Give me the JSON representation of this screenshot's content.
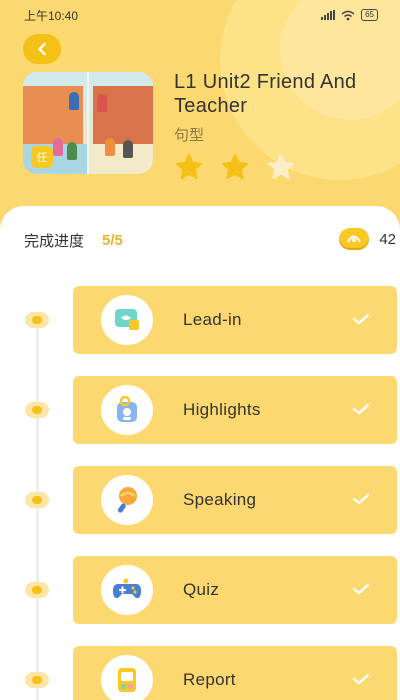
{
  "status_bar": {
    "time": "上午10:40",
    "battery": "65"
  },
  "header": {
    "title": "L1 Unit2 Friend And Teacher",
    "subtitle": "句型",
    "cover_badge": "任",
    "stars_filled": 2,
    "stars_total": 3
  },
  "progress": {
    "label": "完成进度",
    "value": "5/5",
    "coins": "42"
  },
  "lessons": [
    {
      "label": "Lead-in",
      "icon": "book-bubble-icon",
      "completed": true
    },
    {
      "label": "Highlights",
      "icon": "flashcard-icon",
      "completed": true
    },
    {
      "label": "Speaking",
      "icon": "microphone-icon",
      "completed": true
    },
    {
      "label": "Quiz",
      "icon": "gamepad-icon",
      "completed": true
    },
    {
      "label": "Report",
      "icon": "report-icon",
      "completed": true
    }
  ],
  "colors": {
    "accent": "#f5c116",
    "card": "#fcd970",
    "progress_value": "#e7b42f"
  }
}
